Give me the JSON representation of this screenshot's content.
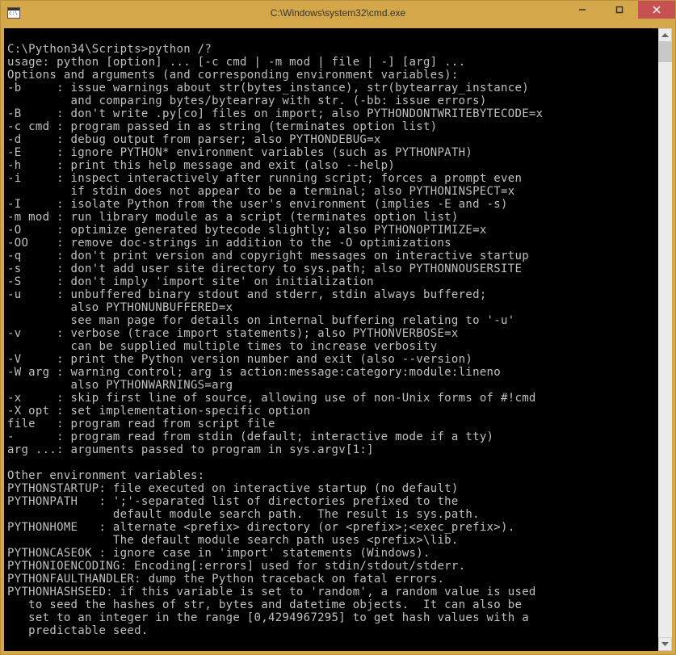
{
  "window": {
    "title": "C:\\Windows\\system32\\cmd.exe"
  },
  "console": {
    "lines": [
      "",
      "C:\\Python34\\Scripts>python /?",
      "usage: python [option] ... [-c cmd | -m mod | file | -] [arg] ...",
      "Options and arguments (and corresponding environment variables):",
      "-b     : issue warnings about str(bytes_instance), str(bytearray_instance)",
      "         and comparing bytes/bytearray with str. (-bb: issue errors)",
      "-B     : don't write .py[co] files on import; also PYTHONDONTWRITEBYTECODE=x",
      "-c cmd : program passed in as string (terminates option list)",
      "-d     : debug output from parser; also PYTHONDEBUG=x",
      "-E     : ignore PYTHON* environment variables (such as PYTHONPATH)",
      "-h     : print this help message and exit (also --help)",
      "-i     : inspect interactively after running script; forces a prompt even",
      "         if stdin does not appear to be a terminal; also PYTHONINSPECT=x",
      "-I     : isolate Python from the user's environment (implies -E and -s)",
      "-m mod : run library module as a script (terminates option list)",
      "-O     : optimize generated bytecode slightly; also PYTHONOPTIMIZE=x",
      "-OO    : remove doc-strings in addition to the -O optimizations",
      "-q     : don't print version and copyright messages on interactive startup",
      "-s     : don't add user site directory to sys.path; also PYTHONNOUSERSITE",
      "-S     : don't imply 'import site' on initialization",
      "-u     : unbuffered binary stdout and stderr, stdin always buffered;",
      "         also PYTHONUNBUFFERED=x",
      "         see man page for details on internal buffering relating to '-u'",
      "-v     : verbose (trace import statements); also PYTHONVERBOSE=x",
      "         can be supplied multiple times to increase verbosity",
      "-V     : print the Python version number and exit (also --version)",
      "-W arg : warning control; arg is action:message:category:module:lineno",
      "         also PYTHONWARNINGS=arg",
      "-x     : skip first line of source, allowing use of non-Unix forms of #!cmd",
      "-X opt : set implementation-specific option",
      "file   : program read from script file",
      "-      : program read from stdin (default; interactive mode if a tty)",
      "arg ...: arguments passed to program in sys.argv[1:]",
      "",
      "Other environment variables:",
      "PYTHONSTARTUP: file executed on interactive startup (no default)",
      "PYTHONPATH   : ';'-separated list of directories prefixed to the",
      "               default module search path.  The result is sys.path.",
      "PYTHONHOME   : alternate <prefix> directory (or <prefix>;<exec_prefix>).",
      "               The default module search path uses <prefix>\\lib.",
      "PYTHONCASEOK : ignore case in 'import' statements (Windows).",
      "PYTHONIOENCODING: Encoding[:errors] used for stdin/stdout/stderr.",
      "PYTHONFAULTHANDLER: dump the Python traceback on fatal errors.",
      "PYTHONHASHSEED: if this variable is set to 'random', a random value is used",
      "   to seed the hashes of str, bytes and datetime objects.  It can also be",
      "   set to an integer in the range [0,4294967295] to get hash values with a",
      "   predictable seed."
    ]
  }
}
